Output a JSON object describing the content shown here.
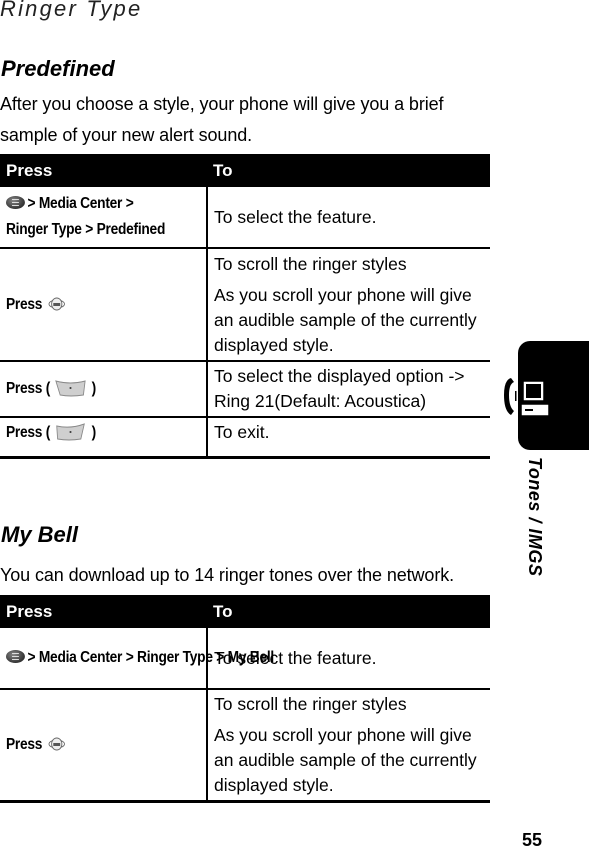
{
  "page_header": "Ringer Type",
  "sections": [
    {
      "title": "Predefined",
      "intro_lines": [
        "After you choose a style, your phone will give you a brief",
        "sample of your new alert sound."
      ],
      "table": {
        "headers": [
          "Press",
          "To"
        ],
        "rows": [
          {
            "press": "> Media Center > Ringer Type > Predefined",
            "press_icon": "menu-key-icon",
            "to": [
              "To select the feature."
            ]
          },
          {
            "press": "Press",
            "press_icon": "nav-key-icon",
            "to": [
              "To scroll the ringer styles",
              "As you scroll your phone will give an audible sample of the currently displayed style."
            ]
          },
          {
            "press_prefix": "Press (",
            "press_suffix": ")",
            "press_icon": "right-soft-key-icon",
            "to": [
              "To select the displayed option -> Ring 21(Default: Acoustica)"
            ]
          },
          {
            "press_prefix": "Press (",
            "press_suffix": ")",
            "press_icon": "left-soft-key-icon",
            "to": [
              "To exit."
            ]
          }
        ]
      }
    },
    {
      "title": "My Bell",
      "intro_lines": [
        "You can download up to 14 ringer tones over the network."
      ],
      "table": {
        "headers": [
          "Press",
          "To"
        ],
        "rows": [
          {
            "press": "> Media Center > Ringer Type > My Bell",
            "press_icon": "menu-key-icon",
            "to": [
              "To select the feature."
            ]
          },
          {
            "press": "Press",
            "press_icon": "nav-key-icon",
            "to": [
              "To scroll the ringer styles",
              "As you scroll your phone will give an audible sample of the currently displayed style."
            ]
          }
        ]
      }
    }
  ],
  "side_tab": {
    "label": "Tones / IMGS",
    "icon": "phone-computer-icon"
  },
  "page_number": "55"
}
